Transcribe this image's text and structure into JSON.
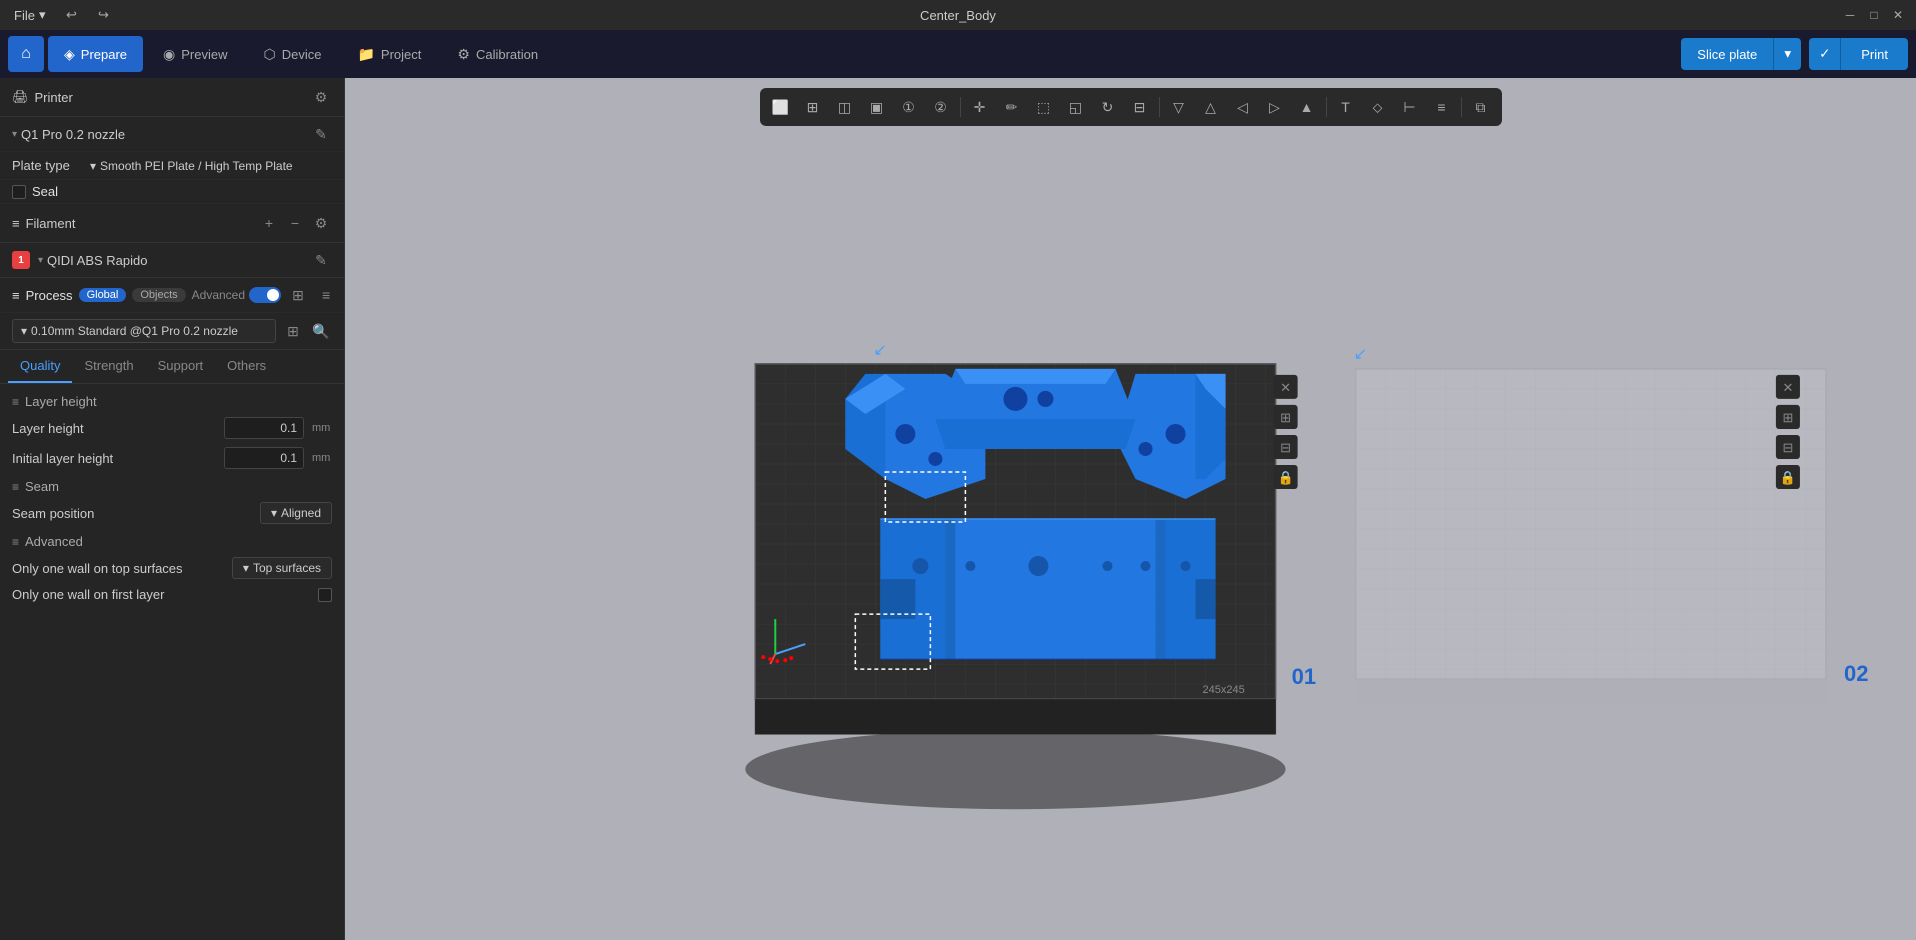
{
  "window": {
    "title": "Center_Body",
    "controls": [
      "minimize",
      "maximize",
      "close"
    ]
  },
  "titlebar": {
    "file_label": "File",
    "undo_icon": "↩",
    "redo_icon": "↪"
  },
  "navbar": {
    "home_icon": "⌂",
    "tabs": [
      {
        "id": "prepare",
        "label": "Prepare",
        "icon": "◈",
        "active": true
      },
      {
        "id": "preview",
        "label": "Preview",
        "icon": "◉",
        "active": false
      },
      {
        "id": "device",
        "label": "Device",
        "icon": "⬡",
        "active": false
      },
      {
        "id": "project",
        "label": "Project",
        "icon": "📁",
        "active": false
      },
      {
        "id": "calibration",
        "label": "Calibration",
        "icon": "⚙",
        "active": false
      }
    ],
    "slice_label": "Slice plate",
    "print_label": "Print"
  },
  "sidebar": {
    "printer_section_label": "Printer",
    "printer_name": "Q1 Pro 0.2 nozzle",
    "plate_type_label": "Plate type",
    "plate_value": "Smooth PEI Plate / High Temp Plate",
    "seal_label": "Seal",
    "filament_section_label": "Filament",
    "filament_items": [
      {
        "id": "1",
        "color": "#e84040",
        "name": "QIDI ABS Rapido"
      }
    ],
    "process_label": "Process",
    "process_tags": [
      "Global",
      "Objects"
    ],
    "advanced_label": "Advanced",
    "profile_value": "0.10mm Standard @Q1 Pro 0.2 nozzle"
  },
  "settings_tabs": [
    {
      "id": "quality",
      "label": "Quality",
      "active": true
    },
    {
      "id": "strength",
      "label": "Strength",
      "active": false
    },
    {
      "id": "support",
      "label": "Support",
      "active": false
    },
    {
      "id": "others",
      "label": "Others",
      "active": false
    }
  ],
  "quality": {
    "layer_height_group": "Layer height",
    "layer_height_label": "Layer height",
    "layer_height_value": "0.1",
    "layer_height_unit": "mm",
    "initial_layer_height_label": "Initial layer height",
    "initial_layer_height_value": "0.1",
    "initial_layer_height_unit": "mm",
    "seam_group": "Seam",
    "seam_position_label": "Seam position",
    "seam_position_value": "Aligned",
    "advanced_group": "Advanced",
    "top_surfaces_label": "Only one wall on top surfaces",
    "top_surfaces_value": "Top surfaces",
    "first_layer_label": "Only one wall on first layer",
    "first_layer_checked": false
  },
  "viewport": {
    "plate1_label": "01",
    "plate2_label": "02",
    "dimensions": "245x245"
  }
}
